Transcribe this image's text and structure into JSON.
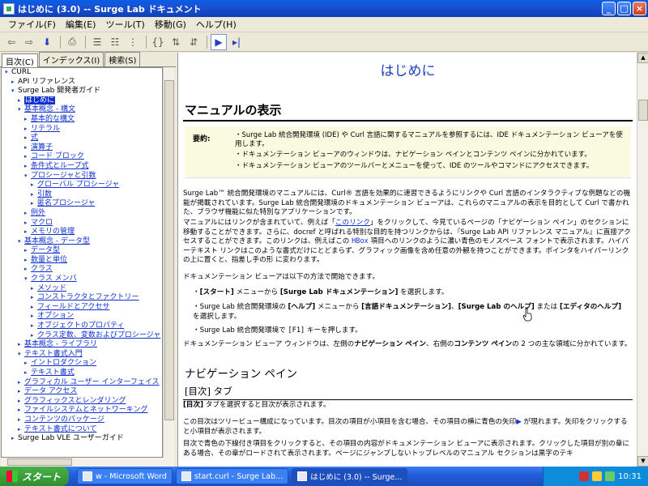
{
  "window": {
    "title": "はじめに (3.0) -- Surge Lab ドキュメント"
  },
  "menu": [
    "ファイル(F)",
    "編集(E)",
    "ツール(T)",
    "移動(G)",
    "ヘルプ(H)"
  ],
  "nav_tabs": [
    "目次(C)",
    "インデックス(I)",
    "検索(S)"
  ],
  "tree": [
    {
      "label": "CURL",
      "level": 0,
      "toggle": "▾",
      "style": "plain"
    },
    {
      "label": "API リファレンス",
      "level": 1,
      "toggle": "▸",
      "style": "plain"
    },
    {
      "label": "Surge Lab 開発者ガイド",
      "level": 1,
      "toggle": "▾",
      "style": "plain"
    },
    {
      "label": "はじめに",
      "level": 2,
      "toggle": "▸",
      "style": "hl"
    },
    {
      "label": "基本概念 - 構文",
      "level": 2,
      "toggle": "▾",
      "style": "link"
    },
    {
      "label": "基本的な構文",
      "level": 3,
      "toggle": "▸",
      "style": "link"
    },
    {
      "label": "リテラル",
      "level": 3,
      "toggle": "▸",
      "style": "link"
    },
    {
      "label": "式",
      "level": 3,
      "toggle": "▸",
      "style": "link"
    },
    {
      "label": "演算子",
      "level": 3,
      "toggle": "▸",
      "style": "link"
    },
    {
      "label": "コード ブロック",
      "level": 3,
      "toggle": "▸",
      "style": "link"
    },
    {
      "label": "条件式とループ式",
      "level": 3,
      "toggle": "▸",
      "style": "link"
    },
    {
      "label": "プロシージャと引数",
      "level": 3,
      "toggle": "▾",
      "style": "link"
    },
    {
      "label": "グローバル プロシージャ",
      "level": 4,
      "toggle": "▸",
      "style": "link"
    },
    {
      "label": "引数",
      "level": 4,
      "toggle": "▸",
      "style": "link"
    },
    {
      "label": "匿名プロシージャ",
      "level": 4,
      "toggle": "▸",
      "style": "link"
    },
    {
      "label": "例外",
      "level": 3,
      "toggle": "▸",
      "style": "link"
    },
    {
      "label": "マクロ",
      "level": 3,
      "toggle": "▸",
      "style": "link"
    },
    {
      "label": "メモリの管理",
      "level": 3,
      "toggle": "▸",
      "style": "link"
    },
    {
      "label": "基本概念 - データ型",
      "level": 2,
      "toggle": "▾",
      "style": "link"
    },
    {
      "label": "データ型",
      "level": 3,
      "toggle": "▸",
      "style": "link"
    },
    {
      "label": "数量と単位",
      "level": 3,
      "toggle": "▸",
      "style": "link"
    },
    {
      "label": "クラス",
      "level": 3,
      "toggle": "▸",
      "style": "link"
    },
    {
      "label": "クラス メンバ",
      "level": 3,
      "toggle": "▾",
      "style": "link"
    },
    {
      "label": "メソッド",
      "level": 4,
      "toggle": "▸",
      "style": "link"
    },
    {
      "label": "コンストラクタとファクトリー",
      "level": 4,
      "toggle": "▸",
      "style": "link"
    },
    {
      "label": "フィールドとアクセサ",
      "level": 4,
      "toggle": "▸",
      "style": "link"
    },
    {
      "label": "オプション",
      "level": 4,
      "toggle": "▸",
      "style": "link"
    },
    {
      "label": "オブジェクトのプロパティ",
      "level": 4,
      "toggle": "▸",
      "style": "link"
    },
    {
      "label": "クラス定数、変数およびプロシージャ",
      "level": 4,
      "toggle": "▸",
      "style": "link"
    },
    {
      "label": "基本概念 - ライブラリ",
      "level": 2,
      "toggle": "▸",
      "style": "link"
    },
    {
      "label": "テキスト書式入門",
      "level": 2,
      "toggle": "▾",
      "style": "link"
    },
    {
      "label": "イントロダクション",
      "level": 3,
      "toggle": "▸",
      "style": "link"
    },
    {
      "label": "テキスト書式",
      "level": 3,
      "toggle": "▸",
      "style": "link"
    },
    {
      "label": "グラフィカル ユーザー インターフェイス",
      "level": 2,
      "toggle": "▸",
      "style": "link"
    },
    {
      "label": "データ アクセス",
      "level": 2,
      "toggle": "▸",
      "style": "link"
    },
    {
      "label": "グラフィックスとレンダリング",
      "level": 2,
      "toggle": "▸",
      "style": "link"
    },
    {
      "label": "ファイルシステムとネットワーキング",
      "level": 2,
      "toggle": "▸",
      "style": "link"
    },
    {
      "label": "コンテンツのパッケージ",
      "level": 2,
      "toggle": "▸",
      "style": "link"
    },
    {
      "label": "テキスト書式について",
      "level": 2,
      "toggle": "▸",
      "style": "link"
    },
    {
      "label": "Surge Lab VLE ユーザーガイド",
      "level": 1,
      "toggle": "▸",
      "style": "plain"
    }
  ],
  "content": {
    "page_title": "はじめに",
    "h1": "マニュアルの表示",
    "summary_key": "要約:",
    "summary": [
      "・Surge Lab 統合開発環境 (IDE) や Curl 言語に関するマニュアルを参照するには、IDE ドキュメンテーション ビューアを使用します。",
      "・ドキュメンテーション ビューアのウィンドウは、ナビゲーション ペインとコンテンツ ペインに分かれています。",
      "・ドキュメンテーション ビューアのツールバーとメニューを使って、IDE のツールやコマンドにアクセスできます。"
    ],
    "para1": "Surge Lab™ 統合開発環境のマニュアルには、Curl® 言語を効果的に速習できるようにリンクや Curl 言語のインタラクティブな例題などの機能が掲載されています。Surge Lab 統合開発環境のドキュメンテーション ビューアは、これらのマニュアルの表示を目的として Curl で書かれた、ブラウザ機能に似た特別なアプリケーションです。",
    "para2_a": "マニュアルにはリンクが含まれていて、例えば「",
    "para2_link": "このリンク",
    "para2_b": "」をクリックして、今見ているページの「ナビゲーション ペイン」のセクションに移動することができます。さらに、docref と呼ばれる特別な目的を持つリンクからは、『Surge Lab API リファレンス マニュアル』に直接アクセスすることができます。このリンクは、例えばこの ",
    "para2_code": "HBox",
    "para2_c": " 項目へのリンクのように濃い青色のモノスペース フォントで表示されます。ハイパーテキスト リンクはこのような書式だけにとどまらず、グラフィック画像を含め任意の外観を持つことができます。ポインタをハイパーリンクの上に置くと、指差し手の形",
    "para2_d": " に変わります。",
    "para3": "ドキュメンテーション ビューアは以下の方法で開始できます。",
    "b1_a": "[スタート]",
    "b1_b": " メニューから ",
    "b1_c": "[Surge Lab ドキュメンテーション]",
    "b1_d": " を選択します。",
    "b2_a": "Surge Lab 統合開発環境の ",
    "b2_b": "[ヘルプ]",
    "b2_c": " メニューから ",
    "b2_d": "[言語ドキュメンテーション]",
    "b2_e": "、",
    "b2_f": "[Surge Lab のヘルプ]",
    "b2_g": " または ",
    "b2_h": "[エディタのヘルプ]",
    "b2_i": " を選択します。",
    "b3_a": "Surge Lab 統合開発環境で ",
    "b3_b": "[F1]",
    "b3_c": " キーを押します。",
    "para4_a": "ドキュメンテーション ビューア ウィンドウは、左側の",
    "para4_b": "ナビゲーション ペイン",
    "para4_c": "、右側の",
    "para4_d": "コンテンツ ペイン",
    "para4_e": "の 2 つの主な領域に分かれています。",
    "h2": "ナビゲーション ペイン",
    "h3": "[目次] タブ",
    "para5_a": "[目次]",
    "para5_b": " タブを選択すると目次が表示されます。",
    "para6": "この目次はツリービュー構成になっています。目次の項目が小項目を含む場合、その項目の横に青色の矢印",
    "para6_b": " が現れます。矢印をクリックすると小項目が表示されます。",
    "para7": "目次で青色の下線付き項目をクリックすると、その項目の内容がドキュメンテーション ビューアに表示されます。クリックした項目が別の章にある場合、その章がロードされて表示されます。ページにジャンプしないトップレベルのマニュアル セクションは黒字のテキ"
  },
  "taskbar": {
    "start": "スタート",
    "tasks": [
      "w - Microsoft Word",
      "start.curl - Surge Lab...",
      "はじめに (3.0) -- Surge..."
    ],
    "clock": "10:31"
  },
  "colors": {
    "link": "#1030d0",
    "title_blue": "#2040c0",
    "summary_bg": "#fafae0"
  }
}
